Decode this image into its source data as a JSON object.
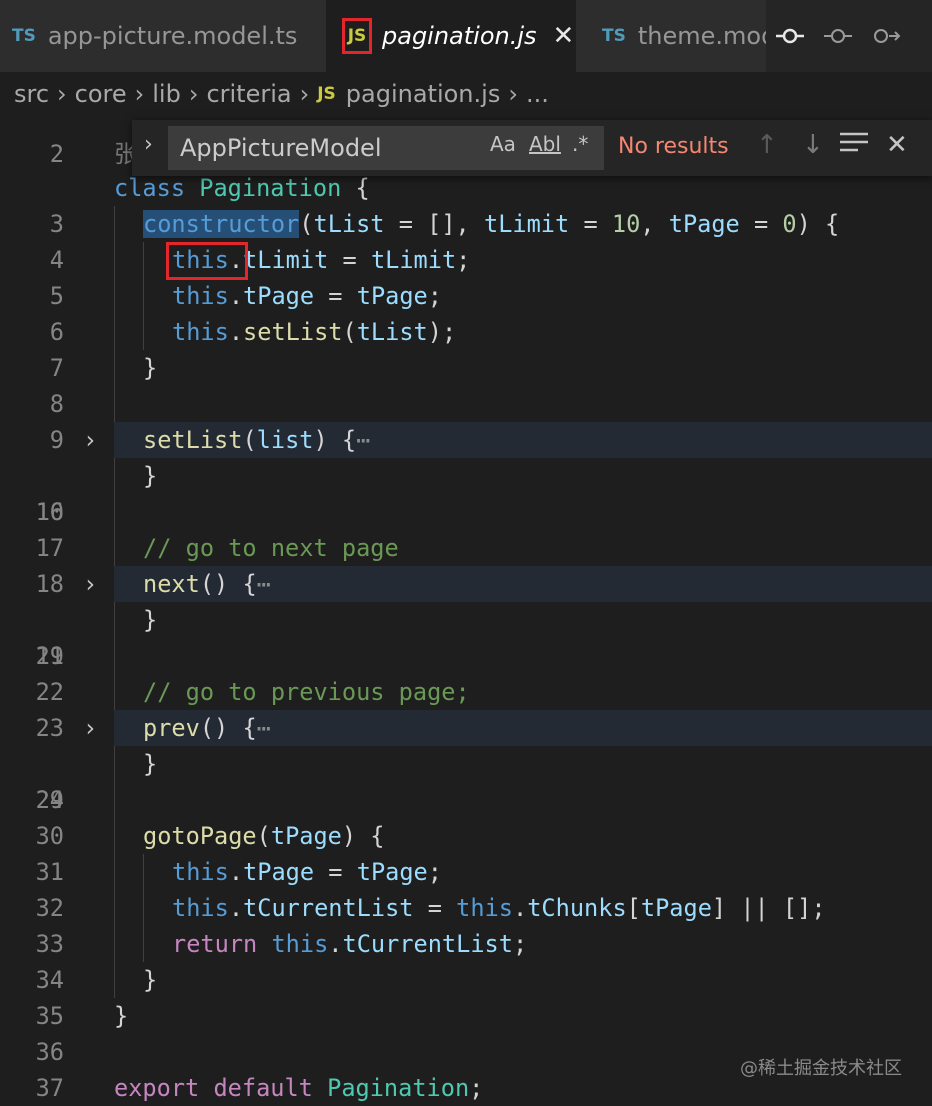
{
  "tabs": [
    {
      "badge": "TS",
      "label": "app-picture.model.ts"
    },
    {
      "badge": "JS",
      "label": "pagination.js",
      "close": "✕"
    },
    {
      "badge": "TS",
      "label": "theme.mode"
    }
  ],
  "breadcrumb": {
    "items": [
      "src",
      "core",
      "lib",
      "criteria"
    ],
    "file_badge": "JS",
    "file": "pagination.js",
    "trail": "...",
    "sep": "›"
  },
  "find": {
    "toggle": "›",
    "value": "AppPictureModel",
    "match_case": "Aa",
    "whole_word": "Abl",
    "regex": ".*",
    "status": "No results"
  },
  "editor": {
    "hidden_line_number": "2",
    "hidden_line_fragment": "张",
    "watermark": "@稀土掘金技术社区"
  },
  "colors": {
    "background": "#1e1e1e",
    "keyword": "#569cd6",
    "control_keyword": "#c586c0",
    "class": "#4ec9b0",
    "function": "#dcdcaa",
    "parameter": "#9cdcfe",
    "number": "#b5cea8",
    "comment": "#6a9955",
    "highlight_box": "#e3262b",
    "no_results": "#f48771"
  }
}
